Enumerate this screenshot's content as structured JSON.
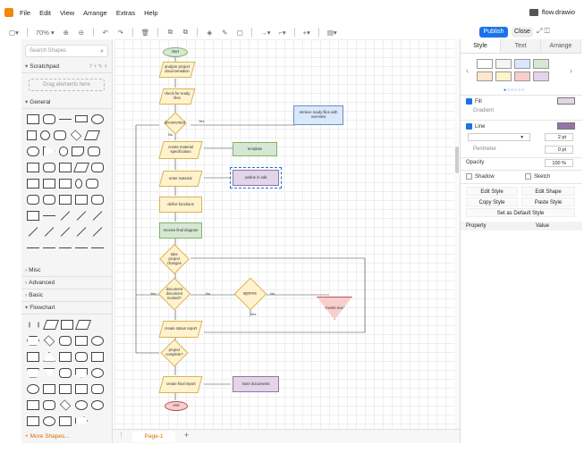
{
  "app": {
    "menu": [
      "File",
      "Edit",
      "View",
      "Arrange",
      "Extras",
      "Help"
    ],
    "file_title": "flow.drawio",
    "publish": "Publish",
    "close": "Close"
  },
  "toolbar": {
    "zoom": "70%",
    "items": [
      "▢▾",
      "70% ▾",
      "⊕",
      "⊖",
      "↶",
      "↷",
      "🗑",
      "⧉",
      "⧉",
      "◈",
      "✎",
      "▢",
      "→▾",
      "⌐▾",
      "+▾",
      "▤▾"
    ]
  },
  "left": {
    "search_placeholder": "Search Shapes",
    "scratchpad": "Scratchpad",
    "scratch_tools": "? + ✎ ×",
    "drag_here": "Drag elements here",
    "general": "General",
    "misc": "Misc",
    "advanced": "Advanced",
    "basic": "Basic",
    "flowchart": "Flowchart",
    "more_shapes": "+ More Shapes..."
  },
  "canvas": {
    "nodes": {
      "start": "start",
      "analyze": "analyze project documentation",
      "check": "check for ready files",
      "documented": "documented",
      "retrieve": "retrieve ready files with overview",
      "create": "create material specification",
      "template": "template",
      "enter": "enter material",
      "outline": "outline in edit",
      "define": "define functions",
      "receive": "receive final diagram",
      "approve": "take project changes",
      "wait": "approve",
      "document": "document document revised?",
      "comments": "comments reached",
      "create_status": "create status report",
      "project": "project complete?",
      "final_report": "create final report",
      "store": "store documents",
      "end": "end",
      "yes1": "Yes",
      "no1": "No",
      "yes2": "Yes",
      "no2": "No",
      "yes3": "Yes",
      "no3": "No"
    }
  },
  "bottom": {
    "page_tab": "Page-1",
    "add": "+"
  },
  "right": {
    "tabs": [
      "Style",
      "Text",
      "Arrange"
    ],
    "swatches": [
      "#ffffff",
      "#f5f5f5",
      "#dae8fc",
      "#d5e8d4",
      "#ffe6cc",
      "#fff2cc",
      "#f8cecc",
      "#e1d5e7"
    ],
    "fill": "Fill",
    "gradient": "Gradient",
    "line": "Line",
    "line_width": "2 pt",
    "perimeter": "Perimeter",
    "perimeter_val": "0 pt",
    "opacity": "Opacity",
    "opacity_val": "100 %",
    "shadow": "Shadow",
    "sketch": "Sketch",
    "edit_style": "Edit Style",
    "edit_shape": "Edit Shape",
    "copy_style": "Copy Style",
    "paste_style": "Paste Style",
    "set_default": "Set as Default Style",
    "property": "Property",
    "value": "Value",
    "fill_color": "#e1d5e7",
    "line_color": "#9673a6"
  }
}
